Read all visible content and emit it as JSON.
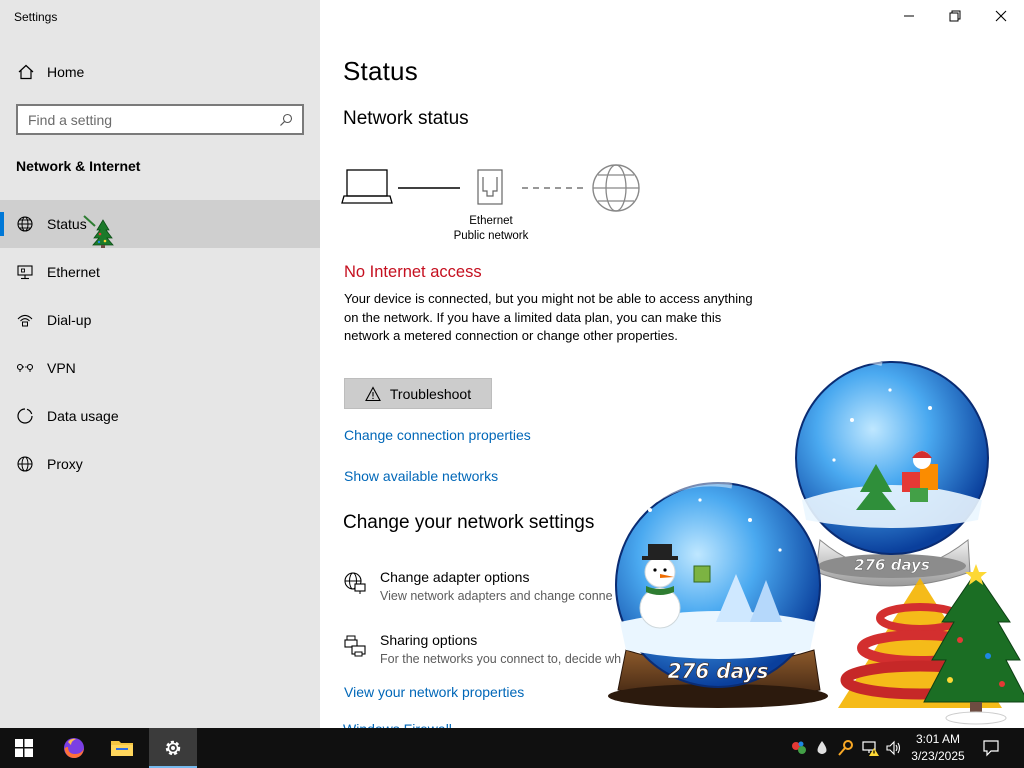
{
  "app": {
    "title": "Settings"
  },
  "sidebar": {
    "home_label": "Home",
    "search_placeholder": "Find a setting",
    "section_title": "Network & Internet",
    "items": [
      {
        "label": "Status",
        "icon": "globe-status-icon",
        "selected": true
      },
      {
        "label": "Ethernet",
        "icon": "ethernet-icon",
        "selected": false
      },
      {
        "label": "Dial-up",
        "icon": "dialup-icon",
        "selected": false
      },
      {
        "label": "VPN",
        "icon": "vpn-icon",
        "selected": false
      },
      {
        "label": "Data usage",
        "icon": "data-usage-icon",
        "selected": false
      },
      {
        "label": "Proxy",
        "icon": "globe-icon",
        "selected": false
      }
    ]
  },
  "main": {
    "page_title": "Status",
    "network_status_heading": "Network status",
    "diagram": {
      "adapter_name": "Ethernet",
      "network_type": "Public network"
    },
    "connection_state": "No Internet access",
    "description": "Your device is connected, but you might not be able to access anything on the network. If you have a limited data plan, you can make this network a metered connection or change other properties.",
    "troubleshoot_label": "Troubleshoot",
    "links": {
      "change_connection_properties": "Change connection properties",
      "show_available_networks": "Show available networks",
      "view_network_properties": "View your network properties",
      "windows_firewall": "Windows Firewall"
    },
    "change_settings_heading": "Change your network settings",
    "options": [
      {
        "title": "Change adapter options",
        "subtitle": "View network adapters and change conne",
        "icon": "adapter-globe-icon"
      },
      {
        "title": "Sharing options",
        "subtitle": "For the networks you connect to, decide wh",
        "icon": "sharing-printer-icon"
      }
    ]
  },
  "decoration": {
    "days_label_left": "276 days",
    "days_label_right": "276 days"
  },
  "taskbar": {
    "apps": [
      "start-icon",
      "firefox-icon",
      "file-explorer-icon",
      "settings-gear-icon"
    ],
    "clock_time": "3:01 AM",
    "clock_date": "3/23/2025"
  },
  "colors": {
    "accent": "#0078d7",
    "link": "#0067b8",
    "error": "#c50f1f",
    "sidebar_bg": "#e6e6e6",
    "taskbar_bg": "#101010"
  }
}
